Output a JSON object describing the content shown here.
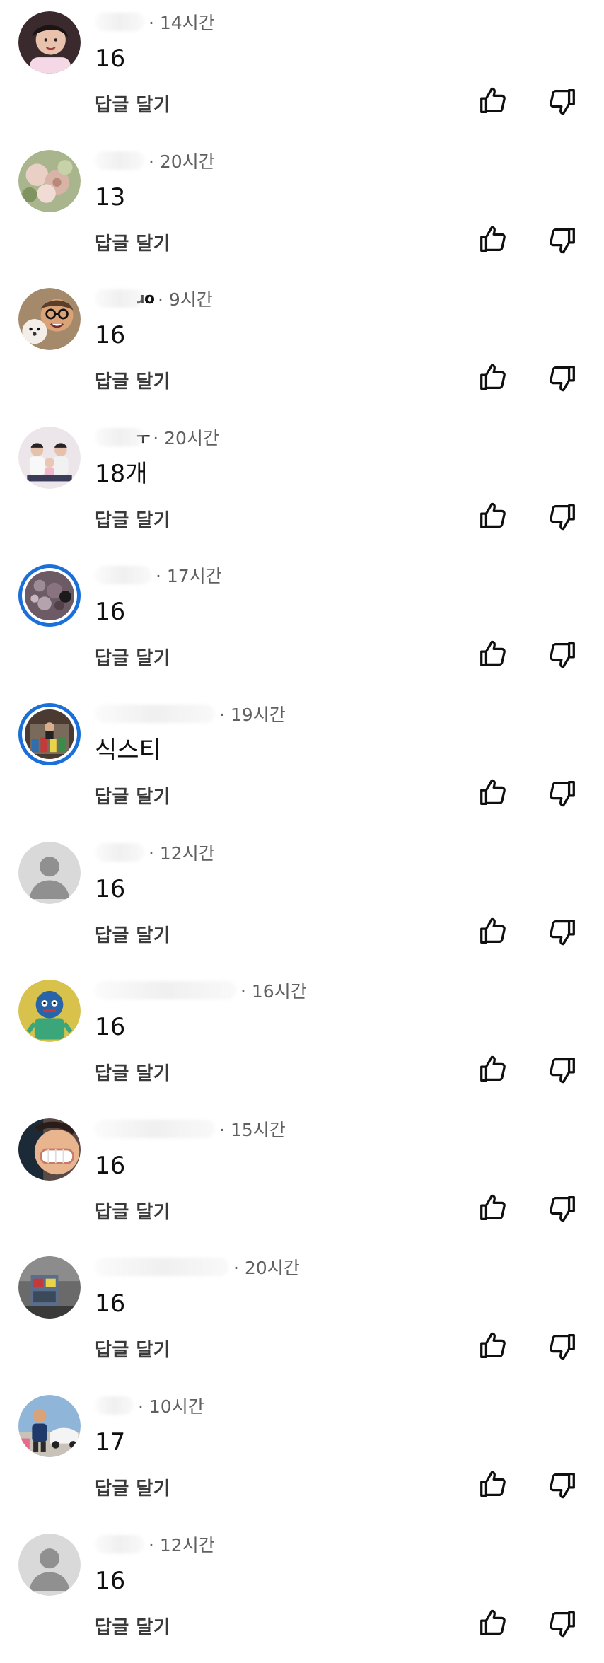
{
  "reply_label": "답글 달기",
  "comments": [
    {
      "time": "· 14시간",
      "text": "16",
      "author_fragment": "",
      "blur_width": 70,
      "avatar": "photo-woman"
    },
    {
      "time": "· 20시간",
      "text": "13",
      "author_fragment": "",
      "blur_width": 70,
      "avatar": "photo-flowers"
    },
    {
      "time": "· 9시간",
      "text": "16",
      "author_fragment": "ɹo",
      "blur_width": 70,
      "avatar": "photo-man-dog"
    },
    {
      "time": "· 20시간",
      "text": "18개",
      "author_fragment": "ㅜ",
      "blur_width": 70,
      "avatar": "photo-kids"
    },
    {
      "time": "· 17시간",
      "text": "16",
      "author_fragment": "",
      "blur_width": 80,
      "avatar": "photo-moss-ring"
    },
    {
      "time": "· 19시간",
      "text": "식스티",
      "author_fragment": "",
      "blur_width": 170,
      "avatar": "photo-shop-ring"
    },
    {
      "time": "· 12시간",
      "text": "16",
      "author_fragment": "",
      "blur_width": 70,
      "avatar": "default-person"
    },
    {
      "time": "· 16시간",
      "text": "16",
      "author_fragment": "",
      "blur_width": 200,
      "avatar": "photo-cartoon"
    },
    {
      "time": "· 15시간",
      "text": "16",
      "author_fragment": "",
      "blur_width": 170,
      "avatar": "photo-smile"
    },
    {
      "time": "· 20시간",
      "text": "16",
      "author_fragment": "",
      "blur_width": 190,
      "avatar": "photo-street"
    },
    {
      "time": "· 10시간",
      "text": "17",
      "author_fragment": "",
      "blur_width": 55,
      "avatar": "photo-car"
    },
    {
      "time": "· 12시간",
      "text": "16",
      "author_fragment": "",
      "blur_width": 70,
      "avatar": "default-person"
    }
  ],
  "icons": {
    "like": "thumbs-up-icon",
    "dislike": "thumbs-down-icon"
  },
  "colors": {
    "ring": "#1a6fd8",
    "meta_text": "#606060",
    "body_text": "#0f0f0f",
    "icon_stroke": "#0f0f0f"
  }
}
